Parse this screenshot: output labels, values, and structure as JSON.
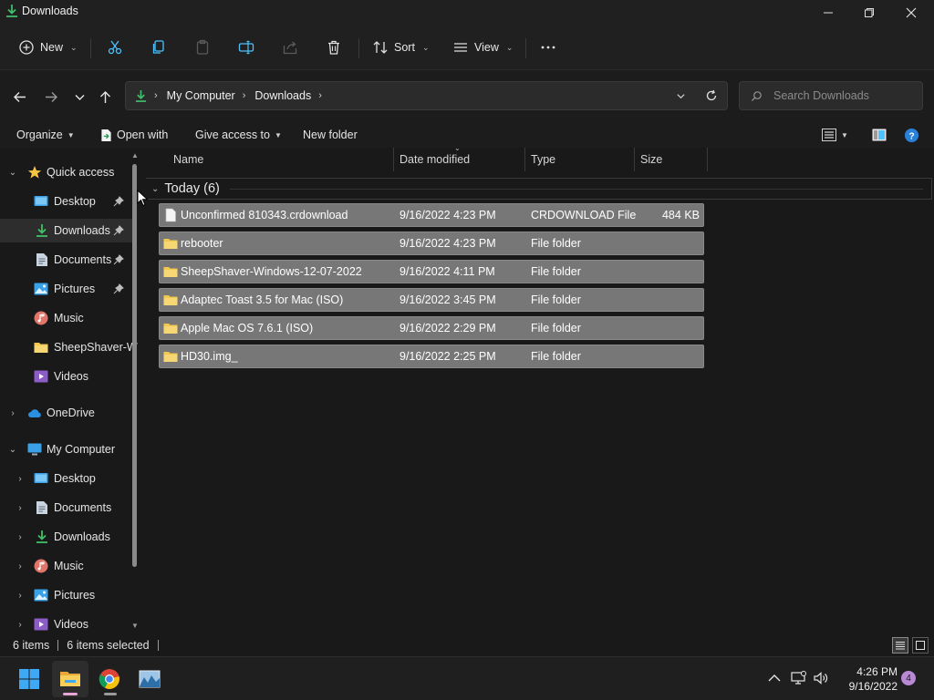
{
  "window": {
    "title": "Downloads",
    "minimize_icon": "minimize-icon",
    "maximize_icon": "restore-icon",
    "close_icon": "close-icon"
  },
  "commandbar": {
    "new_label": "New",
    "sort_label": "Sort",
    "view_label": "View",
    "icons": [
      "add-icon",
      "cut-icon",
      "copy-icon",
      "paste-icon",
      "rename-icon",
      "share-icon",
      "delete-icon",
      "sort-icon",
      "view-icon",
      "more-icon"
    ]
  },
  "address": {
    "crumbs": [
      "My Computer",
      "Downloads"
    ],
    "search_placeholder": "Search Downloads"
  },
  "toolbar": {
    "organize_label": "Organize",
    "open_with_label": "Open with",
    "give_access_label": "Give access to",
    "new_folder_label": "New folder"
  },
  "navpane": {
    "quick_access": {
      "label": "Quick access",
      "items": [
        {
          "label": "Desktop",
          "icon": "desktop-icon",
          "pinned": true
        },
        {
          "label": "Downloads",
          "icon": "download-icon",
          "pinned": true,
          "selected": true
        },
        {
          "label": "Documents",
          "icon": "documents-icon",
          "pinned": true
        },
        {
          "label": "Pictures",
          "icon": "pictures-icon",
          "pinned": true
        },
        {
          "label": "Music",
          "icon": "music-icon",
          "pinned": false
        },
        {
          "label": "SheepShaver-W",
          "icon": "folder-icon",
          "pinned": false
        },
        {
          "label": "Videos",
          "icon": "videos-icon",
          "pinned": false
        }
      ]
    },
    "onedrive_label": "OneDrive",
    "my_computer": {
      "label": "My Computer",
      "items": [
        {
          "label": "Desktop",
          "icon": "desktop-icon"
        },
        {
          "label": "Documents",
          "icon": "documents-icon"
        },
        {
          "label": "Downloads",
          "icon": "download-icon"
        },
        {
          "label": "Music",
          "icon": "music-icon"
        },
        {
          "label": "Pictures",
          "icon": "pictures-icon"
        },
        {
          "label": "Videos",
          "icon": "videos-icon"
        }
      ]
    }
  },
  "columns": [
    "Name",
    "Date modified",
    "Type",
    "Size"
  ],
  "group": {
    "label": "Today (6)"
  },
  "files": [
    {
      "name": "Unconfirmed 810343.crdownload",
      "date": "9/16/2022 4:23 PM",
      "type": "CRDOWNLOAD File",
      "size": "484 KB",
      "icon": "file-icon"
    },
    {
      "name": "rebooter",
      "date": "9/16/2022 4:23 PM",
      "type": "File folder",
      "size": "",
      "icon": "folder-icon"
    },
    {
      "name": "SheepShaver-Windows-12-07-2022",
      "date": "9/16/2022 4:11 PM",
      "type": "File folder",
      "size": "",
      "icon": "folder-icon"
    },
    {
      "name": "Adaptec Toast 3.5 for Mac (ISO)",
      "date": "9/16/2022 3:45 PM",
      "type": "File folder",
      "size": "",
      "icon": "folder-icon"
    },
    {
      "name": "Apple Mac OS 7.6.1 (ISO)",
      "date": "9/16/2022 2:29 PM",
      "type": "File folder",
      "size": "",
      "icon": "folder-icon"
    },
    {
      "name": "HD30.img_",
      "date": "9/16/2022 2:25 PM",
      "type": "File folder",
      "size": "",
      "icon": "folder-icon"
    }
  ],
  "status": {
    "item_count": "6 items",
    "selected_count": "6 items selected"
  },
  "taskbar": {
    "time": "4:26 PM",
    "date": "9/16/2022",
    "notification_count": "4",
    "apps": [
      "windows-start-icon",
      "file-explorer-icon",
      "chrome-icon",
      "photo-app-icon"
    ]
  },
  "colors": {
    "accent": "#4cc2ff",
    "selection_row": "#777777",
    "folder": "#f2c94c",
    "download_green": "#3fbf6a"
  }
}
